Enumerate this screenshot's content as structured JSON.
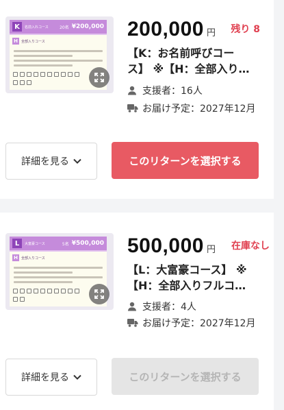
{
  "colors": {
    "accent": "#e85a63",
    "stock_text": "#e04050",
    "disabled_bg": "#e5e5e5",
    "disabled_text": "#b5b5b5",
    "thumb_banner": "#c58bdb"
  },
  "rewards": [
    {
      "thumb": {
        "letter": "K",
        "banner_title": "名前入れコース",
        "slots": "20名",
        "banner_price": "¥200,000",
        "sub_letter": "H",
        "sub_title": "全部入りコース"
      },
      "price": "200,000",
      "yen": "円",
      "stock": "残り 8",
      "title_line1": "【K：お名前呼びコー",
      "title_line2": "ス】 ※【H：全部入り…",
      "supporters": "支援者：16人",
      "delivery": "お届け予定：2027年12月",
      "detail_label": "詳細を見る",
      "select_label": "このリターンを選択する",
      "icons": {
        "zoom": "expand-icon",
        "supporters": "person-icon",
        "delivery": "truck-icon",
        "chevron": "chevron-down-icon"
      }
    },
    {
      "thumb": {
        "letter": "L",
        "banner_title": "大富豪コース",
        "slots": "5名",
        "banner_price": "¥500,000",
        "sub_letter": "H",
        "sub_title": "全部入りコース"
      },
      "price": "500,000",
      "yen": "円",
      "stock": "在庫なし",
      "title_line1": "【L：大富豪コース】 ※",
      "title_line2": "【H：全部入りフルコ…",
      "supporters": "支援者：4人",
      "delivery": "お届け予定：2027年12月",
      "detail_label": "詳細を見る",
      "select_label": "このリターンを選択する",
      "icons": {
        "zoom": "expand-icon",
        "supporters": "person-icon",
        "delivery": "truck-icon",
        "chevron": "chevron-down-icon"
      }
    }
  ]
}
